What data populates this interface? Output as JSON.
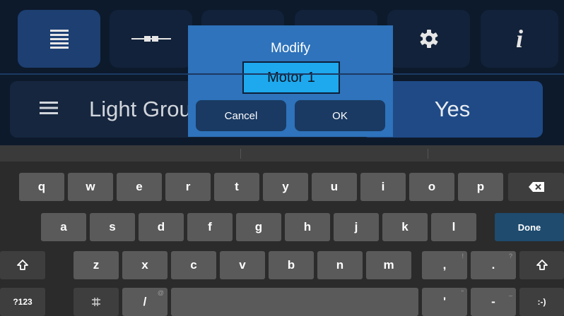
{
  "app": {
    "tabs": [
      {
        "icon": "list-icon",
        "active": true
      },
      {
        "icon": "connector-icon",
        "active": false
      },
      {
        "icon": "hidden-tab-icon",
        "active": false
      },
      {
        "icon": "hidden-tab-icon",
        "active": false
      },
      {
        "icon": "gear-icon",
        "active": false
      },
      {
        "icon": "info-icon",
        "active": false,
        "label": "i"
      }
    ],
    "row_label": "Light Group",
    "yes_label": "Yes"
  },
  "modal": {
    "title": "Modify",
    "input_value": "Motor 1",
    "cancel_label": "Cancel",
    "ok_label": "OK"
  },
  "keyboard": {
    "row1": [
      "q",
      "w",
      "e",
      "r",
      "t",
      "y",
      "u",
      "i",
      "o",
      "p"
    ],
    "row2": [
      "a",
      "s",
      "d",
      "f",
      "g",
      "h",
      "j",
      "k",
      "l"
    ],
    "row3": [
      "z",
      "x",
      "c",
      "v",
      "b",
      "n",
      "m"
    ],
    "comma": ",",
    "comma_hint": "!",
    "period": ".",
    "period_hint": "?",
    "done_label": "Done",
    "symbols_label": "?123",
    "slash": "/",
    "slash_hint": "@",
    "apostrophe": "'",
    "apostrophe_hint": "\"",
    "dash": "-",
    "dash_hint": "_",
    "emoji_label": ":-)",
    "backspace_icon": "backspace-icon",
    "shift_icon": "shift-icon",
    "language_icon": "language-switch-icon"
  },
  "colors": {
    "app_bg": "#0d1a2c",
    "tab_active": "#1d3f72",
    "modal_bg": "#2e73bb",
    "modal_input": "#1ea8ee",
    "key_bg": "#5a5a5a",
    "done_key": "#1e4b6e"
  }
}
